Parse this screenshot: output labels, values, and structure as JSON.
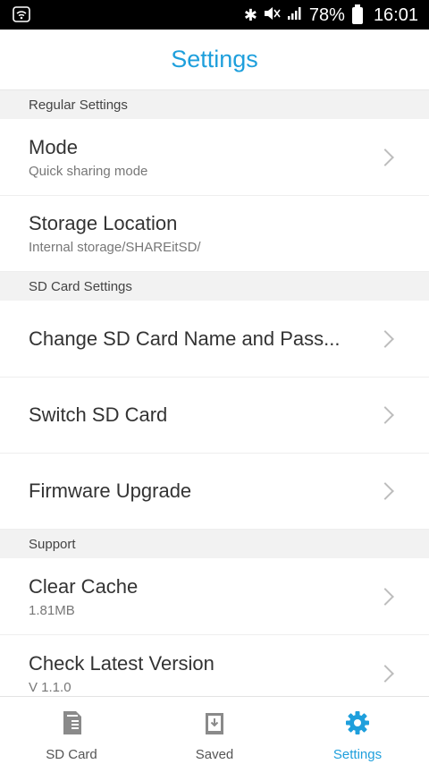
{
  "status_bar": {
    "battery_percent": "78%",
    "time": "16:01",
    "icons": [
      "wifi-icon",
      "bluetooth-icon",
      "mute-icon",
      "signal-icon",
      "battery-icon"
    ]
  },
  "header": {
    "title": "Settings"
  },
  "sections": {
    "regular": {
      "title": "Regular Settings",
      "mode": {
        "title": "Mode",
        "subtitle": "Quick sharing mode"
      },
      "storage": {
        "title": "Storage Location",
        "subtitle": "Internal storage/SHAREitSD/"
      }
    },
    "sdcard": {
      "title": "SD Card Settings",
      "change_name": {
        "title": "Change SD Card Name and Pass..."
      },
      "switch": {
        "title": "Switch SD Card"
      },
      "firmware": {
        "title": "Firmware Upgrade"
      }
    },
    "support": {
      "title": "Support",
      "clear_cache": {
        "title": "Clear Cache",
        "subtitle": "1.81MB"
      },
      "check_version": {
        "title": "Check Latest Version",
        "subtitle": "V 1.1.0"
      }
    }
  },
  "bottom_nav": {
    "sdcard": {
      "label": "SD Card"
    },
    "saved": {
      "label": "Saved"
    },
    "settings": {
      "label": "Settings"
    }
  },
  "colors": {
    "accent": "#1e9fdc",
    "icon_gray": "#8a8a8a"
  }
}
